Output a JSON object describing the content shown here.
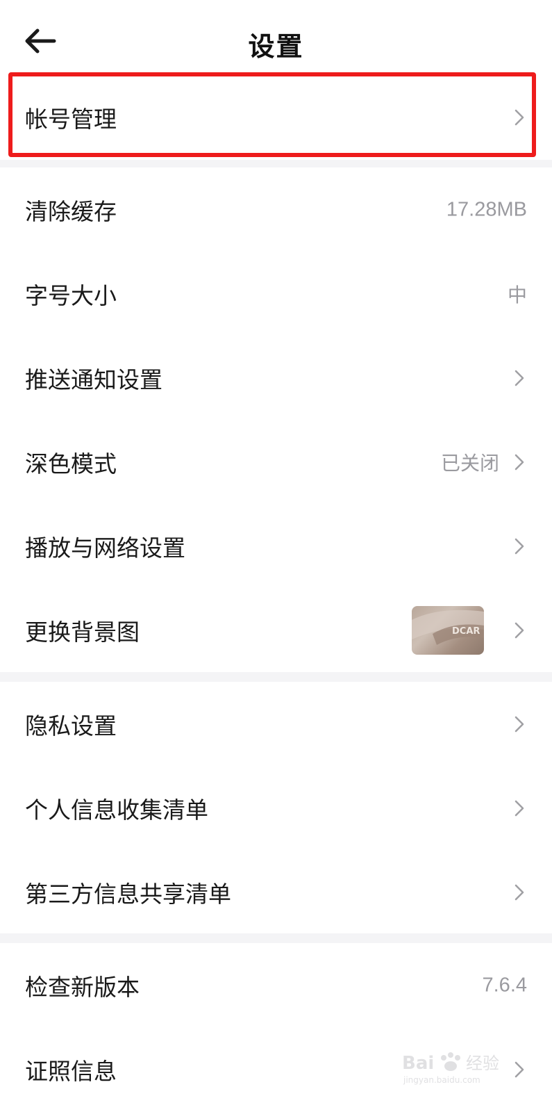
{
  "header": {
    "title": "设置"
  },
  "groups": [
    {
      "items": [
        {
          "label": "帐号管理"
        }
      ]
    },
    {
      "items": [
        {
          "label": "清除缓存",
          "value": "17.28MB"
        },
        {
          "label": "字号大小",
          "value": "中"
        },
        {
          "label": "推送通知设置"
        },
        {
          "label": "深色模式",
          "value": "已关闭"
        },
        {
          "label": "播放与网络设置"
        },
        {
          "label": "更换背景图",
          "thumbnail_text": "DCAR"
        }
      ]
    },
    {
      "items": [
        {
          "label": "隐私设置"
        },
        {
          "label": "个人信息收集清单"
        },
        {
          "label": "第三方信息共享清单"
        }
      ]
    },
    {
      "items": [
        {
          "label": "检查新版本",
          "value": "7.6.4"
        },
        {
          "label": "证照信息"
        }
      ]
    }
  ],
  "colors": {
    "background": "#f4f4f6",
    "card": "#ffffff",
    "text": "#1a1a1a",
    "secondary": "#9a9a9f",
    "highlight_box": "#ee1c1c"
  },
  "icons": {
    "back": "arrow-left-icon",
    "chevron": "chevron-right-icon"
  },
  "watermark": {
    "brand": "Bai",
    "brand_suffix": "经验",
    "url": "jingyan.baidu.com"
  }
}
